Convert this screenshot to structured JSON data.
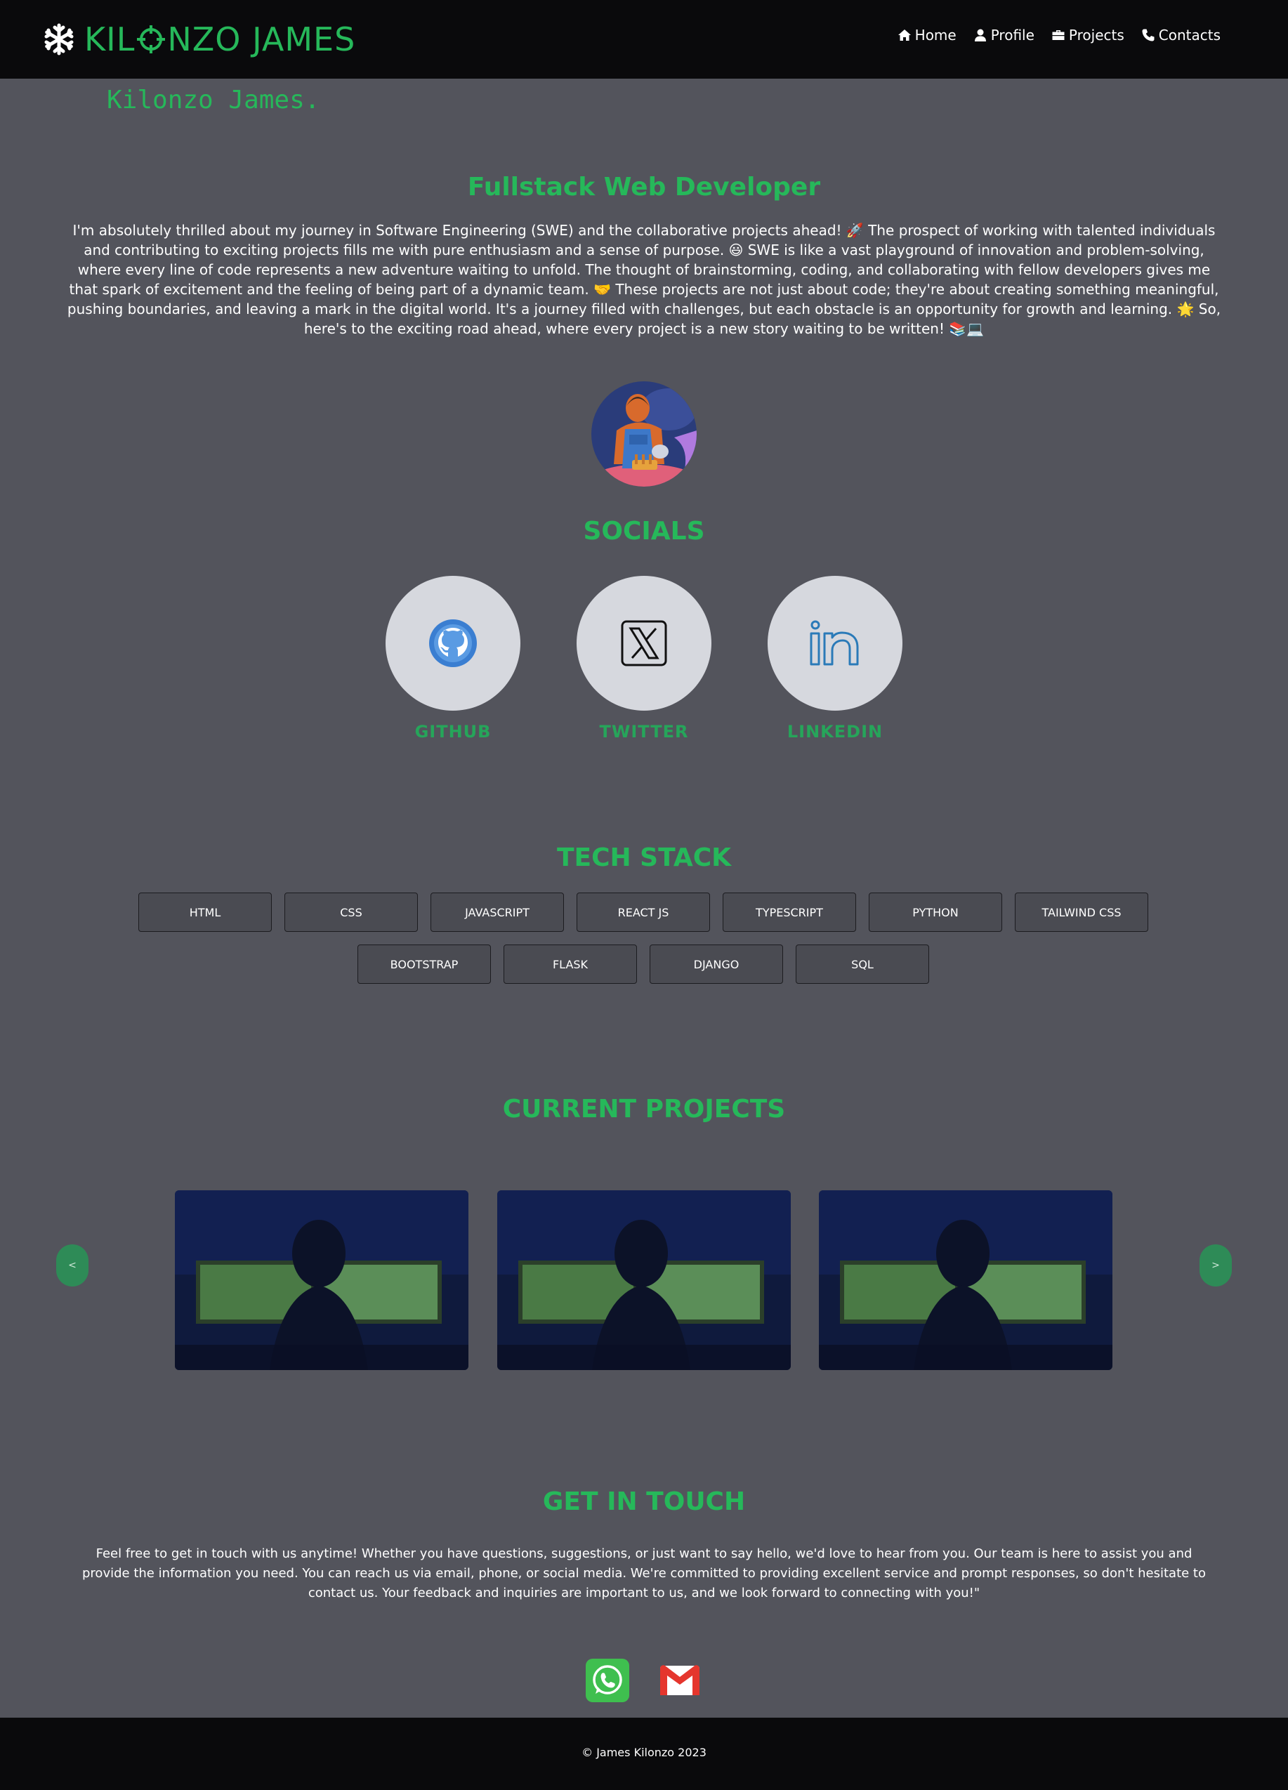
{
  "nav": {
    "brand": "KILONZO JAMES",
    "brand_prefix": "KIL",
    "brand_suffix": "NZO JAMES",
    "links": [
      {
        "label": "Home",
        "icon": "home-icon"
      },
      {
        "label": "Profile",
        "icon": "user-icon"
      },
      {
        "label": "Projects",
        "icon": "briefcase-icon"
      },
      {
        "label": "Contacts",
        "icon": "phone-icon"
      }
    ]
  },
  "hero": {
    "typed_name": "Kilonzo James.",
    "role": "Fullstack Web Developer",
    "intro": "I'm absolutely thrilled about my journey in Software Engineering (SWE) and the collaborative projects ahead! 🚀 The prospect of working with talented individuals and contributing to exciting projects fills me with pure enthusiasm and a sense of purpose. 😃 SWE is like a vast playground of innovation and problem-solving, where every line of code represents a new adventure waiting to unfold. The thought of brainstorming, coding, and collaborating with fellow developers gives me that spark of excitement and the feeling of being part of a dynamic team. 🤝 These projects are not just about code; they're about creating something meaningful, pushing boundaries, and leaving a mark in the digital world. It's a journey filled with challenges, but each obstacle is an opportunity for growth and learning. 🌟 So, here's to the exciting road ahead, where every project is a new story waiting to be written! 📚💻"
  },
  "socials": {
    "title": "SOCIALS",
    "items": [
      {
        "label": "GITHUB",
        "icon": "github-icon"
      },
      {
        "label": "TWITTER",
        "icon": "x-twitter-icon"
      },
      {
        "label": "LINKEDIN",
        "icon": "linkedin-icon"
      }
    ]
  },
  "tech": {
    "title": "TECH STACK",
    "items": [
      "HTML",
      "CSS",
      "JAVASCRIPT",
      "REACT JS",
      "TYPESCRIPT",
      "PYTHON",
      "TAILWIND CSS",
      "BOOTSTRAP",
      "FLASK",
      "DJANGO",
      "SQL"
    ]
  },
  "projects": {
    "title": "CURRENT PROJECTS",
    "prev_label": "<",
    "next_label": ">"
  },
  "contact": {
    "title": "GET IN TOUCH",
    "text": "Feel free to get in touch with us anytime! Whether you have questions, suggestions, or just want to say hello, we'd love to hear from you. Our team is here to assist you and provide the information you need. You can reach us via email, phone, or social media. We're committed to providing excellent service and prompt responses, so don't hesitate to contact us. Your feedback and inquiries are important to us, and we look forward to connecting with you!\""
  },
  "footer": {
    "copyright": "© James Kilonzo 2023"
  },
  "colors": {
    "accent": "#26b85a",
    "background": "#53545c",
    "nav_bg": "#0a0a0c"
  }
}
